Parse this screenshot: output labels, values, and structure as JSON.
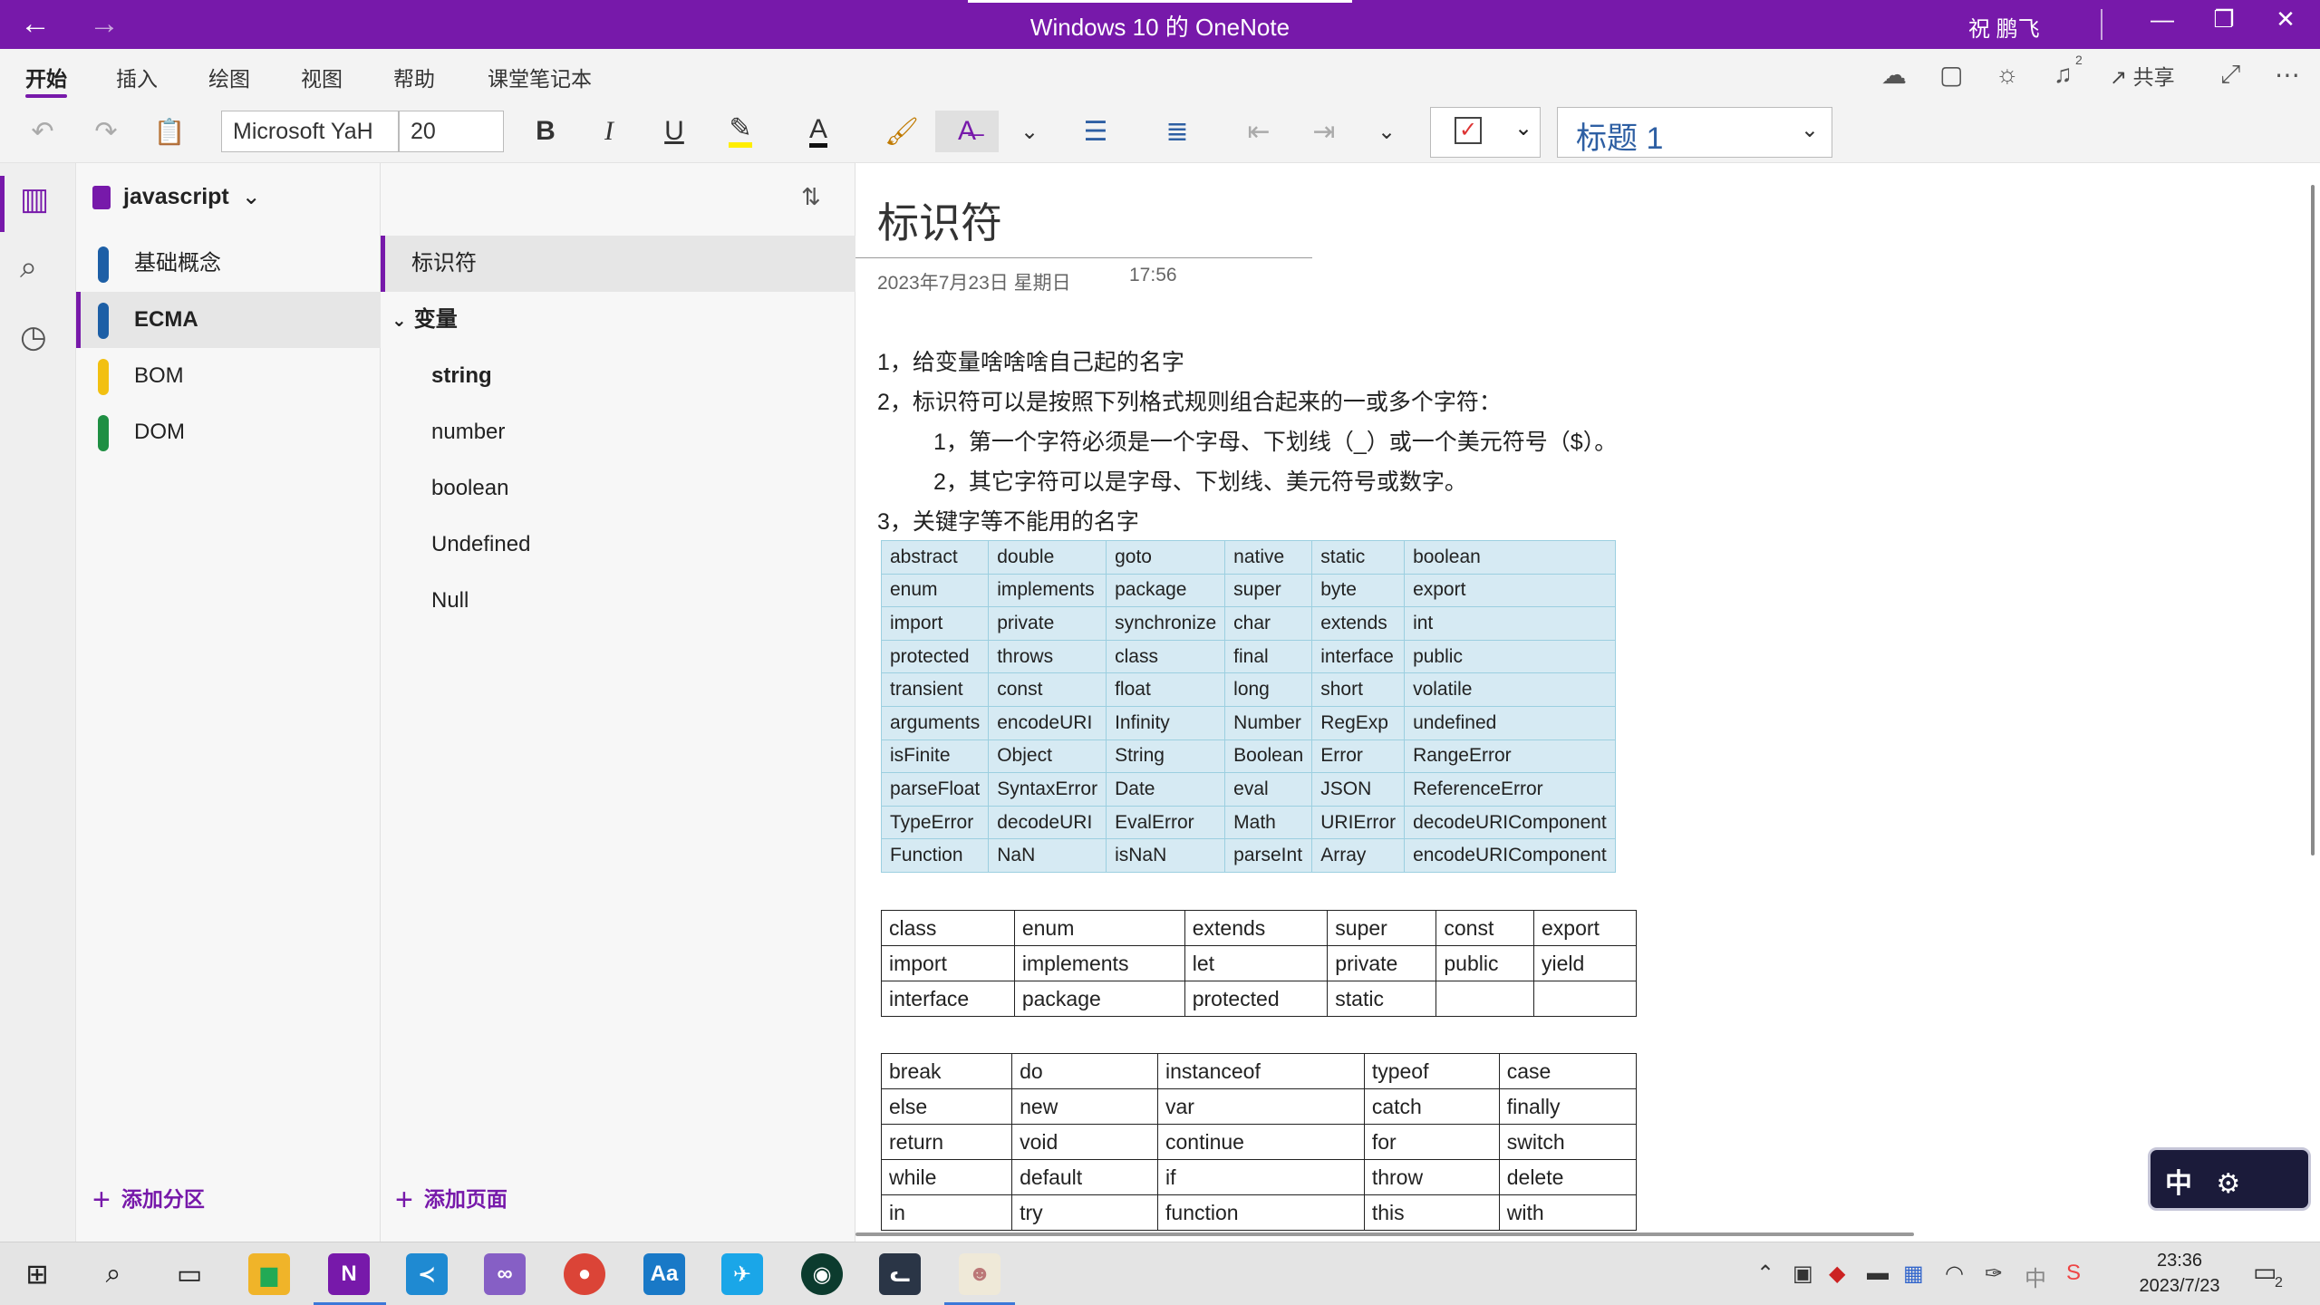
{
  "window": {
    "title": "Windows 10 的 OneNote",
    "user": "祝 鹏飞",
    "back_icon": "←",
    "forward_icon": "→",
    "minimize": "—",
    "maximize": "❐",
    "close": "✕"
  },
  "menu": {
    "tabs": [
      "开始",
      "插入",
      "绘图",
      "视图",
      "帮助",
      "课堂笔记本"
    ],
    "share_label": "共享",
    "notification_count": "2"
  },
  "toolbar": {
    "font_name": "Microsoft YaH",
    "font_size": "20",
    "bold": "B",
    "italic": "I",
    "underline": "U",
    "style_value": "标题 1",
    "highlight_color": "#ffff00",
    "accent_color": "#7719aa"
  },
  "notebook": {
    "name": "javascript",
    "sections": [
      {
        "label": "基础概念",
        "color": "#1d5fa6"
      },
      {
        "label": "ECMA",
        "color": "#1d5fa6"
      },
      {
        "label": "BOM",
        "color": "#f2c011"
      },
      {
        "label": "DOM",
        "color": "#1f8f43"
      }
    ],
    "add_section_label": "添加分区"
  },
  "pages": {
    "items": [
      {
        "label": "标识符"
      },
      {
        "label": "变量"
      },
      {
        "label": "string"
      },
      {
        "label": "number"
      },
      {
        "label": "boolean"
      },
      {
        "label": "Undefined"
      },
      {
        "label": "Null"
      }
    ],
    "add_page_label": "添加页面"
  },
  "page": {
    "title": "标识符",
    "date": "2023年7月23日 星期日",
    "time": "17:56",
    "lines": [
      "1，给变量啥啥啥自己起的名字",
      "2，标识符可以是按照下列格式规则组合起来的一或多个字符：",
      "1，第一个字符必须是一个字母、下划线（_）或一个美元符号（$）。",
      "2，其它字符可以是字母、下划线、美元符号或数字。",
      "3，关键字等不能用的名字"
    ],
    "table1": [
      [
        "abstract",
        "double",
        "goto",
        "native",
        "static",
        "boolean"
      ],
      [
        "enum",
        "implements",
        "package",
        "super",
        "byte",
        "export"
      ],
      [
        "import",
        "private",
        "synchronize",
        "char",
        "extends",
        "int"
      ],
      [
        "protected",
        "throws",
        "class",
        "final",
        "interface",
        "public"
      ],
      [
        "transient",
        "const",
        "float",
        "long",
        "short",
        "volatile"
      ],
      [
        "arguments",
        "encodeURI",
        "Infinity",
        "Number",
        "RegExp",
        "undefined"
      ],
      [
        "isFinite",
        "Object",
        "String",
        "Boolean",
        "Error",
        "RangeError"
      ],
      [
        "parseFloat",
        "SyntaxError",
        "Date",
        "eval",
        "JSON",
        "ReferenceError"
      ],
      [
        "TypeError",
        "decodeURI",
        "EvalError",
        "Math",
        "URIError",
        "decodeURIComponent"
      ],
      [
        "Function",
        "NaN",
        "isNaN",
        "parseInt",
        "Array",
        "encodeURIComponent"
      ]
    ],
    "table2": [
      [
        "class",
        "enum",
        "extends",
        "super",
        "const",
        "export"
      ],
      [
        "import",
        "implements",
        "let",
        "private",
        "public",
        "yield"
      ],
      [
        "interface",
        "package",
        "protected",
        "static",
        "",
        ""
      ]
    ],
    "table3": [
      [
        "break",
        "do",
        "instanceof",
        "typeof",
        "case"
      ],
      [
        "else",
        "new",
        "var",
        "catch",
        "finally"
      ],
      [
        "return",
        "void",
        "continue",
        "for",
        "switch"
      ],
      [
        "while",
        "default",
        "if",
        "throw",
        "delete"
      ],
      [
        "in",
        "try",
        "function",
        "this",
        "with"
      ]
    ]
  },
  "ime": {
    "label": "中"
  },
  "taskbar": {
    "time": "23:36",
    "date": "2023/7/23",
    "notification_count": "2"
  }
}
